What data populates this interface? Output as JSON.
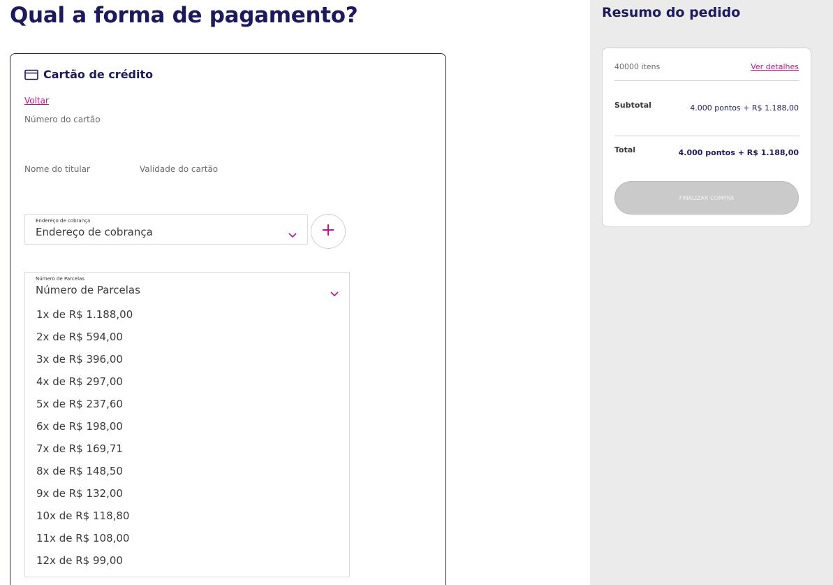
{
  "page": {
    "title": "Qual a forma de pagamento?"
  },
  "payment": {
    "method_title": "Cartão de crédito",
    "method_icon": "credit-card-icon",
    "back_label": "Voltar",
    "card_number_label": "Número do cartão",
    "holder_name_label": "Nome do titular",
    "expiry_label": "Validade do cartão",
    "billing_address": {
      "small_label": "Endereço de cobrança",
      "value": "Endereço de cobrança",
      "add_icon": "plus-icon"
    },
    "installments": {
      "small_label": "Número de Parcelas",
      "value": "Número de Parcelas",
      "options": [
        "1x de R$ 1.188,00",
        "2x de R$ 594,00",
        "3x de R$ 396,00",
        "4x de R$ 297,00",
        "5x de R$ 237,60",
        "6x de R$ 198,00",
        "7x de R$ 169,71",
        "8x de R$ 148,50",
        "9x de R$ 132,00",
        "10x de R$ 118,80",
        "11x de R$ 108,00",
        "12x de R$ 99,00"
      ]
    }
  },
  "summary": {
    "title": "Resumo do pedido",
    "items_count": "40000 itens",
    "details_link": "Ver detalhes",
    "subtotal_label": "Subtotal",
    "subtotal_value": "4.000 pontos + R$ 1.188,00",
    "total_label": "Total",
    "total_value": "4.000 pontos + R$ 1.188,00",
    "finalize_label": "FINALIZAR COMPRA"
  },
  "colors": {
    "primary": "#1c1a5a",
    "accent": "#c0148f",
    "panel_bg": "#ebebeb",
    "disabled_button": "#cacaca"
  }
}
